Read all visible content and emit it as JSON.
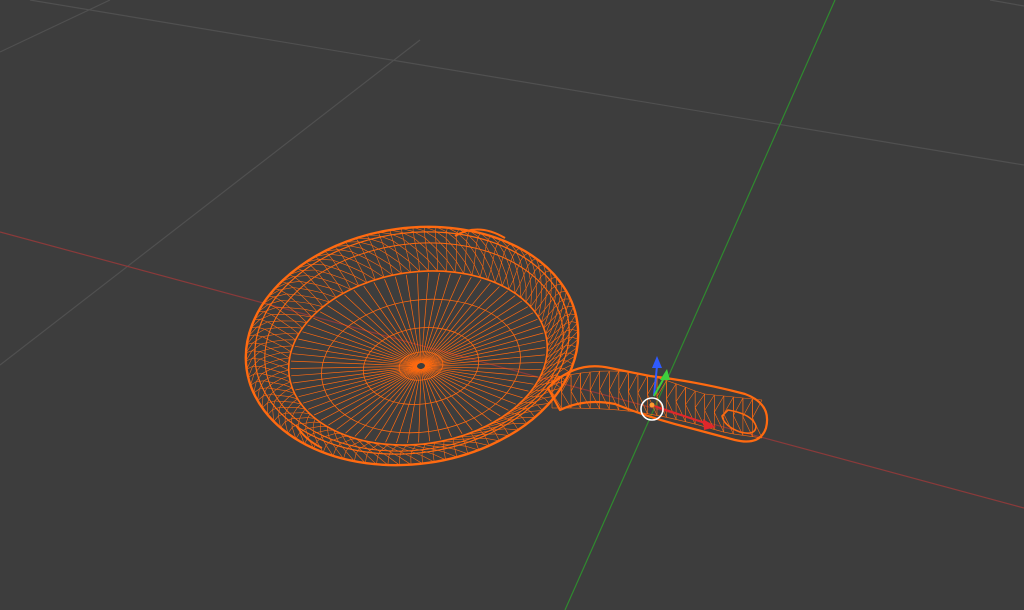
{
  "viewport": {
    "mode": "wireframe",
    "background_color": "#3d3d3d",
    "grid_color": "#505050",
    "x_axis_color": "#8a3a3a",
    "y_axis_color": "#2f8a2f"
  },
  "object": {
    "name_icon": "frying-pan-wireframe",
    "wire_color": "#ff6a10",
    "selected": true
  },
  "gizmo": {
    "x_color": "#e0262b",
    "y_color": "#3ecf3e",
    "z_color": "#2f5bff",
    "cursor_color": "#ffffff"
  }
}
